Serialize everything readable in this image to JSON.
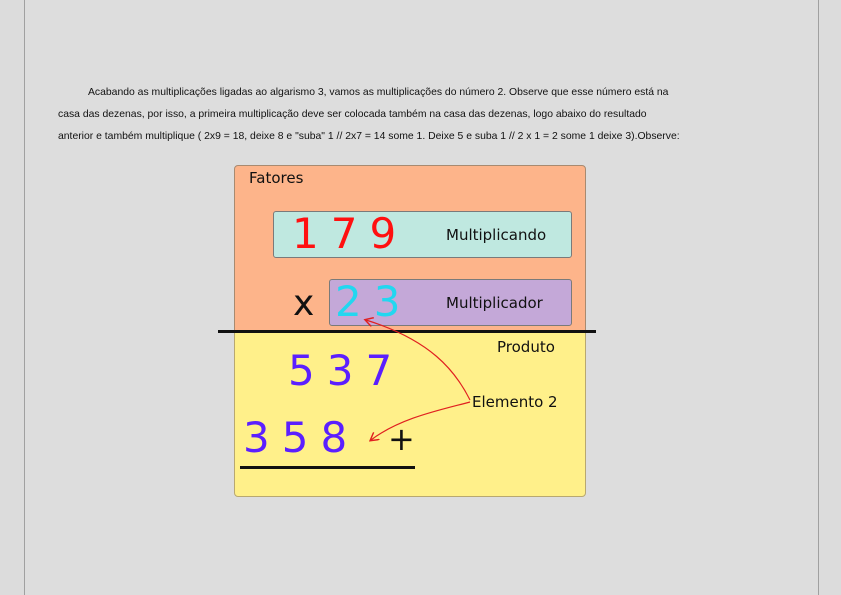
{
  "paragraph": {
    "line1": "Acabando as multiplicações ligadas ao algarismo 3, vamos as multiplicações do número 2. Observe que esse número está na",
    "line2": "casa das dezenas, por isso, a primeira multiplicação deve ser colocada também na casa das dezenas, logo abaixo do resultado",
    "line3": "anterior e também multiplique ( 2x9 = 18, deixe 8 e \"suba\" 1 // 2x7 = 14 some 1. Deixe 5 e suba 1 // 2 x 1 = 2 some 1 deixe 3).Observe:"
  },
  "diagram": {
    "fatores_label": "Fatores",
    "multiplicando": {
      "digits": "179",
      "label": "Multiplicando",
      "color": "#ff1010",
      "bg": "#bfe8e0"
    },
    "operator": "x",
    "multiplicador": {
      "digits": "23",
      "label": "Multiplicador",
      "color": "#22d7f0",
      "bg": "#c4a8d8"
    },
    "produto_label": "Produto",
    "partial1": {
      "digits": "537",
      "color": "#5b1fff"
    },
    "partial2": {
      "digits": "358",
      "color": "#5b1fff"
    },
    "plus": "+",
    "annotation": "Elemento 2",
    "colors": {
      "fatores_bg": "#fdb48a",
      "produto_bg": "#fff08a",
      "arrow": "#e02020"
    }
  }
}
